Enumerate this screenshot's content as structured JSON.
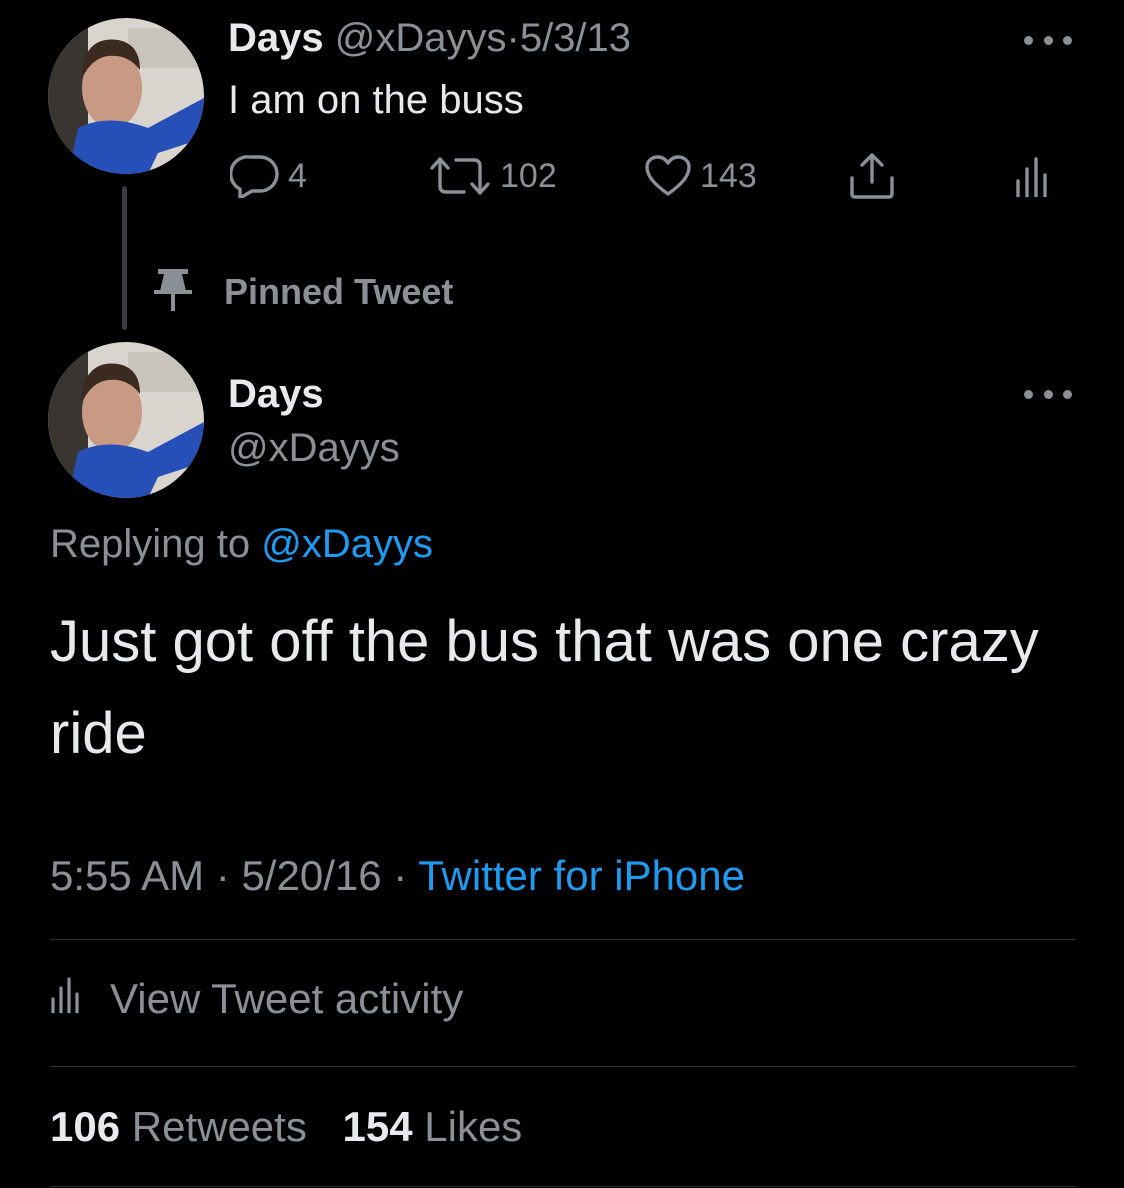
{
  "parent_tweet": {
    "display_name": "Days",
    "handle": "@xDayys",
    "separator": "·",
    "date": "5/3/13",
    "text": "I am on the buss",
    "reply_count": "4",
    "retweet_count": "102",
    "like_count": "143"
  },
  "pinned_label": "Pinned Tweet",
  "main_tweet": {
    "display_name": "Days",
    "handle": "@xDayys",
    "replying_prefix": "Replying to",
    "replying_handle": "@xDayys",
    "text": "Just got off the bus that was one crazy ride",
    "time": "5:55 AM",
    "separator": "·",
    "date": "5/20/16",
    "source": "Twitter for iPhone",
    "activity_label": "View Tweet activity",
    "retweets_count": "106",
    "retweets_label": "Retweets",
    "likes_count": "154",
    "likes_label": "Likes"
  },
  "icons": [
    "more-icon",
    "reply-icon",
    "retweet-icon",
    "like-icon",
    "share-icon",
    "analytics-icon",
    "pin-icon"
  ],
  "colors": {
    "background": "#000000",
    "text": "#e7e9ea",
    "muted": "#8b9096",
    "link": "#1d9bf0",
    "divider": "#2f3336"
  }
}
